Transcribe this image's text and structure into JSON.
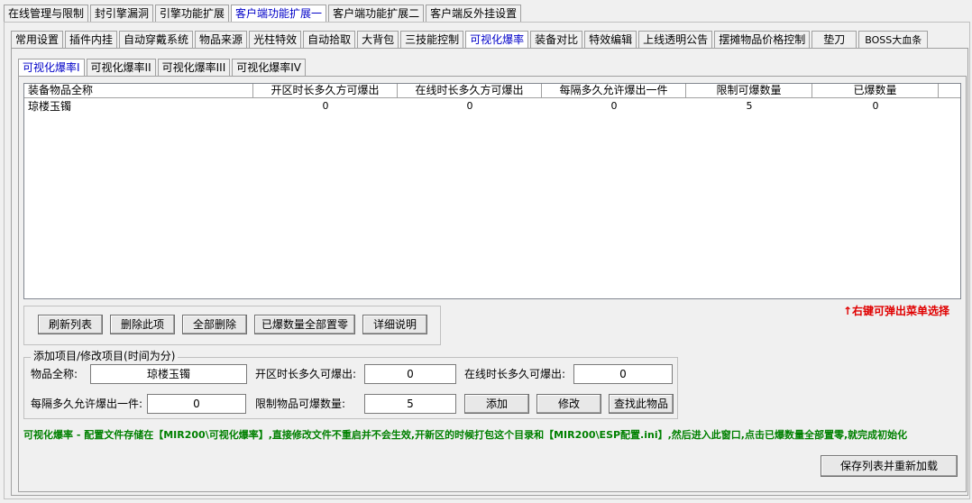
{
  "top_tabs": [
    "在线管理与限制",
    "封引擎漏洞",
    "引擎功能扩展",
    "客户端功能扩展一",
    "客户端功能扩展二",
    "客户端反外挂设置"
  ],
  "top_tab_selected": 3,
  "sub_tabs": [
    "常用设置",
    "插件内挂",
    "自动穿戴系统",
    "物品来源",
    "光柱特效",
    "自动拾取",
    "大背包",
    "三技能控制",
    "可视化爆率",
    "装备对比",
    "特效编辑",
    "上线透明公告",
    "摆摊物品价格控制",
    "垫刀",
    "BOSS大血条"
  ],
  "sub_tab_selected": 8,
  "inner_tabs": [
    "可视化爆率I",
    "可视化爆率II",
    "可视化爆率III",
    "可视化爆率IV"
  ],
  "inner_tab_selected": 0,
  "table": {
    "columns": [
      "装备物品全称",
      "开区时长多久方可爆出",
      "在线时长多久方可爆出",
      "每隔多久允许爆出一件",
      "限制可爆数量",
      "已爆数量"
    ],
    "rows": [
      [
        "琼楼玉镯",
        "0",
        "0",
        "0",
        "5",
        "0"
      ]
    ]
  },
  "action_buttons": [
    "刷新列表",
    "删除此项",
    "全部删除",
    "已爆数量全部置零",
    "详细说明"
  ],
  "right_hint": "↑右键可弹出菜单选择",
  "form": {
    "group_title": "添加项目/修改项目(时间为分)",
    "item_name_label": "物品全称:",
    "item_name_value": "琼楼玉镯",
    "open_time_label": "开区时长多久可爆出:",
    "open_time_value": "0",
    "online_time_label": "在线时长多久可爆出:",
    "online_time_value": "0",
    "interval_label": "每隔多久允许爆出一件:",
    "interval_value": "0",
    "limit_label": "限制物品可爆数量:",
    "limit_value": "5",
    "add_label": "添加",
    "modify_label": "修改",
    "find_label": "查找此物品"
  },
  "note": "可视化爆率 - 配置文件存储在【MIR200\\可视化爆率】,直接修改文件不重启并不会生效,开新区的时候打包这个目录和【MIR200\\ESP配置.ini】,然后进入此窗口,点击已爆数量全部置零,就完成初始化",
  "save_label": "保存列表并重新加载",
  "colors": {
    "selected_tab_text": "#0000c8",
    "hint_red": "#e00000",
    "note_green": "#008000"
  }
}
